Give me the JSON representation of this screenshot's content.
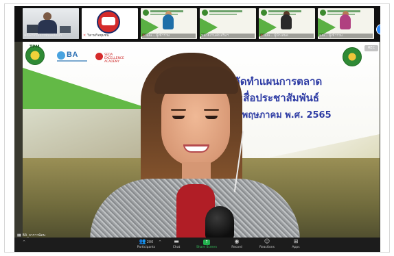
{
  "gallery": {
    "thumbs": [
      {
        "label": "คณะกรรมการขับเคลื่อนฯ",
        "muted": false
      },
      {
        "label": "วิสาหกิจชุมชน",
        "muted": true
      },
      {
        "label": "คุณ... ผู้เข้าร่วม",
        "muted": true
      },
      {
        "label": "หน่วยงานส่งเสริมฯ",
        "muted": false
      },
      {
        "label": "คุณ... ผู้นำเสนอ",
        "muted": true
      },
      {
        "label": "คุณ... ผู้เข้าร่วม",
        "muted": false
      }
    ],
    "next_icon": "chevron-right-icon"
  },
  "slide": {
    "title_line_1": "รจัดทำแผนการตลาด",
    "title_line_2": "ละสื่อประชาสัมพันธ์",
    "title_line_3": "6 พฤษภาคม พ.ศ. 2565",
    "logo_tpm": "TPM",
    "logo_ba": "BA",
    "logo_seda": "SEDA EXCELLENCE ACADEMY",
    "chip": "REC"
  },
  "presenter": {
    "name": "BA_ถาราวนัดน"
  },
  "toolbar": {
    "participants_label": "Participants",
    "participants_count": "200",
    "chat_label": "Chat",
    "share_label": "Share Screen",
    "record_label": "Record",
    "reactions_label": "Reactions",
    "apps_label": "Apps"
  },
  "colors": {
    "slide_title": "#2e3ca4",
    "green_accent": "#63b946",
    "share_green": "#20b14c",
    "zoom_blue": "#2d8cff"
  }
}
